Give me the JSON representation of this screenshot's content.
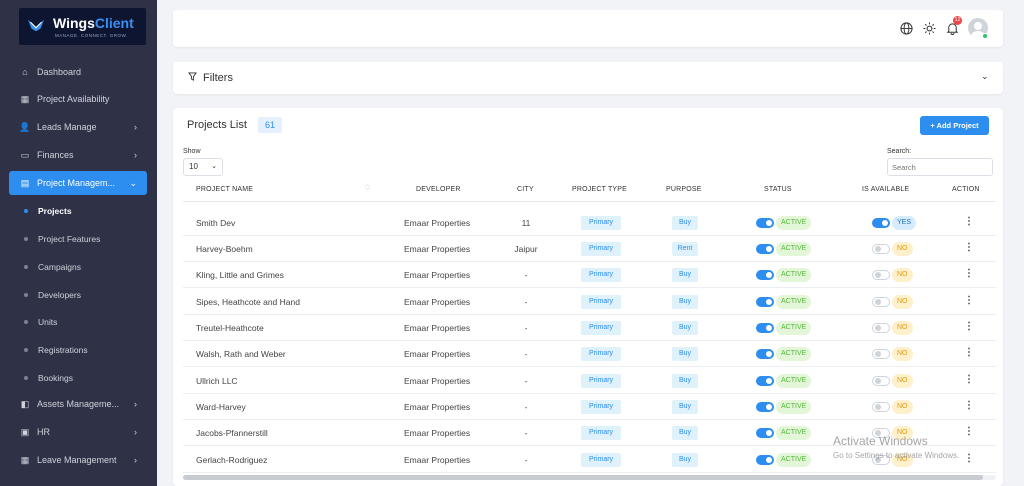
{
  "brand": {
    "name": "Wings",
    "name_accent": "Client",
    "tagline": "MANAGE. CONNECT. GROW."
  },
  "sidebar": {
    "items": [
      {
        "label": "Dashboard",
        "icon": "home-icon"
      },
      {
        "label": "Project Availability",
        "icon": "grid-icon"
      },
      {
        "label": "Leads Manage",
        "icon": "user-plus-icon"
      },
      {
        "label": "Finances",
        "icon": "wallet-icon"
      },
      {
        "label": "Project Managem...",
        "icon": "building-icon"
      }
    ],
    "subitems": [
      "Projects",
      "Project Features",
      "Campaigns",
      "Developers",
      "Units",
      "Registrations",
      "Bookings"
    ],
    "bottom": [
      {
        "label": "Assets Manageme...",
        "icon": "assets-icon"
      },
      {
        "label": "HR",
        "icon": "id-card-icon"
      },
      {
        "label": "Leave Management",
        "icon": "calendar-icon"
      }
    ]
  },
  "header": {
    "notification_count": "12"
  },
  "filters": {
    "label": "Filters"
  },
  "projects": {
    "title": "Projects List",
    "count": "61",
    "add_label": "+ Add Project",
    "show_label": "Show",
    "show_value": "10",
    "search_label": "Search:",
    "search_placeholder": "Search",
    "columns": [
      "PROJECT NAME",
      "DEVELOPER",
      "CITY",
      "PROJECT TYPE",
      "PURPOSE",
      "STATUS",
      "IS AVAILABLE",
      "ACTION"
    ],
    "rows": [
      {
        "name": "Smith Dev",
        "developer": "Emaar Properties",
        "city": "11",
        "type": "Primary",
        "purpose": "Buy",
        "status": "ACTIVE",
        "available": "YES"
      },
      {
        "name": "Harvey-Boehm",
        "developer": "Emaar Properties",
        "city": "Jaipur",
        "type": "Primary",
        "purpose": "Rent",
        "status": "ACTIVE",
        "available": "NO"
      },
      {
        "name": "Kling, Little and Grimes",
        "developer": "Emaar Properties",
        "city": "-",
        "type": "Primary",
        "purpose": "Buy",
        "status": "ACTIVE",
        "available": "NO"
      },
      {
        "name": "Sipes, Heathcote and Hand",
        "developer": "Emaar Properties",
        "city": "-",
        "type": "Primary",
        "purpose": "Buy",
        "status": "ACTIVE",
        "available": "NO"
      },
      {
        "name": "Treutel-Heathcote",
        "developer": "Emaar Properties",
        "city": "-",
        "type": "Primary",
        "purpose": "Buy",
        "status": "ACTIVE",
        "available": "NO"
      },
      {
        "name": "Walsh, Rath and Weber",
        "developer": "Emaar Properties",
        "city": "-",
        "type": "Primary",
        "purpose": "Buy",
        "status": "ACTIVE",
        "available": "NO"
      },
      {
        "name": "Ullrich LLC",
        "developer": "Emaar Properties",
        "city": "-",
        "type": "Primary",
        "purpose": "Buy",
        "status": "ACTIVE",
        "available": "NO"
      },
      {
        "name": "Ward-Harvey",
        "developer": "Emaar Properties",
        "city": "-",
        "type": "Primary",
        "purpose": "Buy",
        "status": "ACTIVE",
        "available": "NO"
      },
      {
        "name": "Jacobs-Pfannerstill",
        "developer": "Emaar Properties",
        "city": "-",
        "type": "Primary",
        "purpose": "Buy",
        "status": "ACTIVE",
        "available": "NO"
      },
      {
        "name": "Gerlach-Rodriguez",
        "developer": "Emaar Properties",
        "city": "-",
        "type": "Primary",
        "purpose": "Buy",
        "status": "ACTIVE",
        "available": "NO"
      }
    ]
  },
  "watermark": {
    "line1": "Activate Windows",
    "line2": "Go to Settings to activate Windows."
  },
  "colors": {
    "accent": "#2d8ef0",
    "sidebar": "#2f3246"
  }
}
